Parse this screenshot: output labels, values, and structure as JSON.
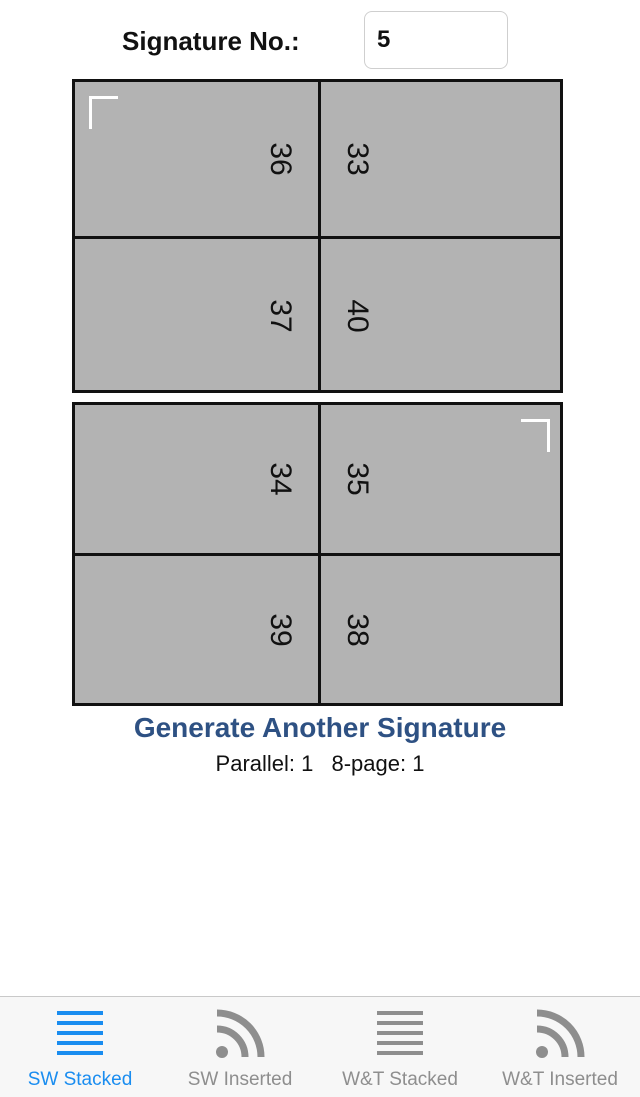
{
  "signature": {
    "label": "Signature No.:",
    "value": "5"
  },
  "sheets": {
    "top": {
      "pages": [
        {
          "number": "36",
          "position": "left"
        },
        {
          "number": "33",
          "position": "right"
        },
        {
          "number": "37",
          "position": "left"
        },
        {
          "number": "40",
          "position": "right"
        }
      ]
    },
    "bottom": {
      "pages": [
        {
          "number": "34",
          "position": "left"
        },
        {
          "number": "35",
          "position": "right"
        },
        {
          "number": "39",
          "position": "left"
        },
        {
          "number": "38",
          "position": "right"
        }
      ]
    },
    "fill_color": "#b3b3b3"
  },
  "generate_link": "Generate Another Signature",
  "stats": {
    "parallel": "Parallel: 1",
    "eight_page": "8-page: 1"
  },
  "tabbar": {
    "active_color": "#1a8df0",
    "inactive_color": "#8e8e8e",
    "tabs": [
      {
        "label": "SW Stacked",
        "icon": "stacked-lines-icon",
        "active": true
      },
      {
        "label": "SW Inserted",
        "icon": "rss-icon",
        "active": false
      },
      {
        "label": "W&T Stacked",
        "icon": "stacked-lines-icon",
        "active": false
      },
      {
        "label": "W&T Inserted",
        "icon": "rss-icon",
        "active": false
      }
    ]
  }
}
